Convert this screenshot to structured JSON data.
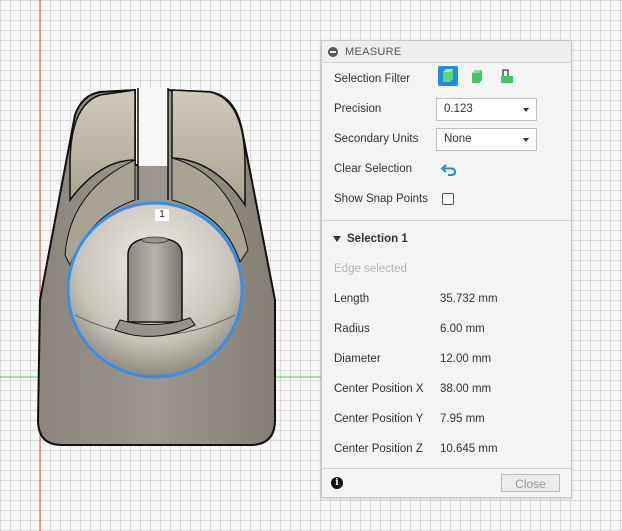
{
  "viewport": {
    "origin_marker": "1"
  },
  "panel": {
    "title": "MEASURE",
    "selection_filter": {
      "label": "Selection Filter",
      "icons": [
        "body-filter-icon",
        "face-filter-icon",
        "edge-filter-icon"
      ]
    },
    "precision": {
      "label": "Precision",
      "value": "0.123"
    },
    "secondary_units": {
      "label": "Secondary Units",
      "value": "None"
    },
    "clear_selection": {
      "label": "Clear Selection"
    },
    "snap_points": {
      "label": "Show Snap Points",
      "checked": false
    },
    "section": {
      "title": "Selection 1",
      "status": "Edge selected",
      "rows": [
        {
          "label": "Length",
          "value": "35.732 mm"
        },
        {
          "label": "Radius",
          "value": "6.00 mm"
        },
        {
          "label": "Diameter",
          "value": "12.00 mm"
        },
        {
          "label": "Center Position X",
          "value": "38.00 mm"
        },
        {
          "label": "Center Position Y",
          "value": "7.95 mm"
        },
        {
          "label": "Center Position Z",
          "value": "10.645 mm"
        }
      ]
    },
    "close_label": "Close"
  },
  "colors": {
    "accent": "#1e8fd8",
    "selection_highlight": "#3a8ee6",
    "axis_red": "#e05050",
    "axis_green": "#66cc66"
  }
}
